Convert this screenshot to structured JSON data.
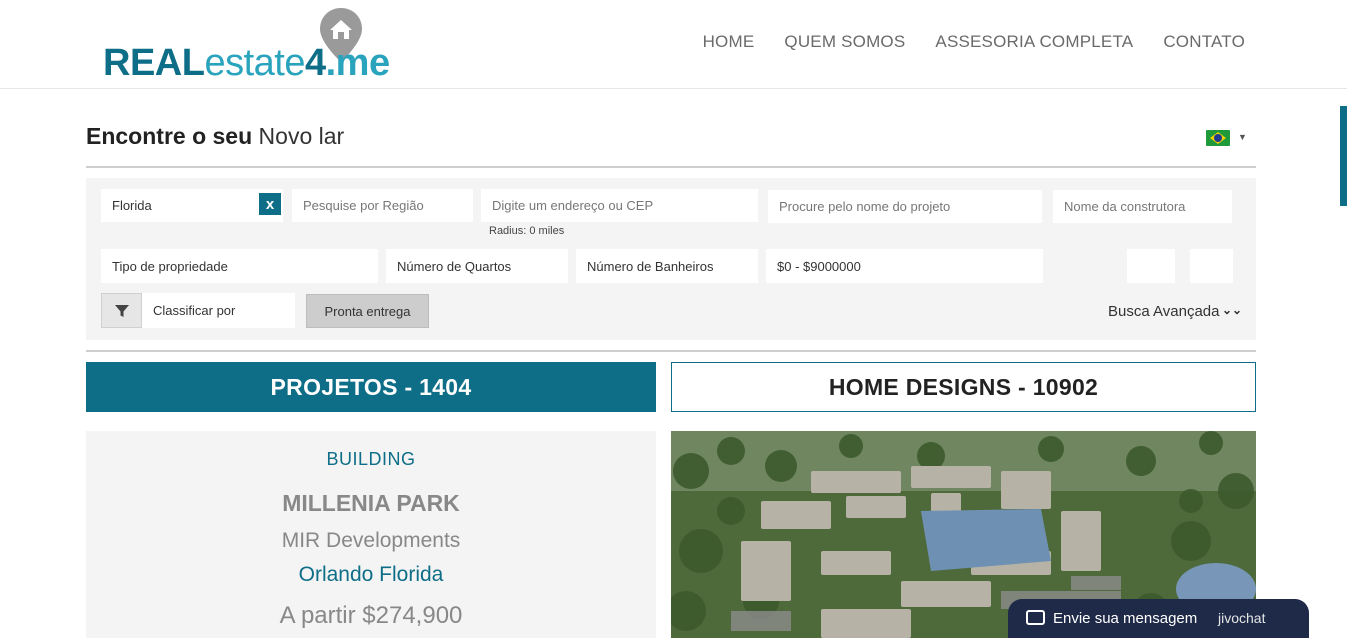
{
  "header": {
    "logo": {
      "part_real": "REAL",
      "part_estate": "estate",
      "part_four": "4",
      "part_me": ".me"
    },
    "nav": [
      {
        "label": "HOME"
      },
      {
        "label": "QUEM SOMOS"
      },
      {
        "label": "ASSESORIA COMPLETA"
      },
      {
        "label": "CONTATO"
      }
    ]
  },
  "search": {
    "title_bold": "Encontre o seu",
    "title_light": "Novo lar",
    "language_flag": "brazil-flag",
    "location_value": "Florida",
    "clear_label": "x",
    "region_placeholder": "Pesquise por Região",
    "address_placeholder": "Digite um endereço ou CEP",
    "radius_label": "Radius: 0 miles",
    "project_placeholder": "Procure pelo nome do projeto",
    "builder_placeholder": "Nome da construtora",
    "property_type": "Tipo de propriedade",
    "bedrooms": "Número de Quartos",
    "bathrooms": "Número de Banheiros",
    "price_range": "$0 - $9000000",
    "sort_label": "Classificar por",
    "ready_button": "Pronta entrega",
    "advanced_label": "Busca Avançada"
  },
  "tabs": {
    "projects": "PROJETOS - 1404",
    "designs": "HOME DESIGNS - 10902"
  },
  "listing": {
    "type": "BUILDING",
    "name": "MILLENIA PARK",
    "developer": "MIR Developments",
    "location": "Orlando Florida",
    "price": "A partir $274,900"
  },
  "chat": {
    "label": "Envie sua mensagem",
    "brand": "jivochat"
  },
  "colors": {
    "brand": "#0e6e87",
    "brand_light": "#2aa3bd",
    "panel_bg": "#f4f4f4",
    "chat_bg": "#1e2a48"
  }
}
